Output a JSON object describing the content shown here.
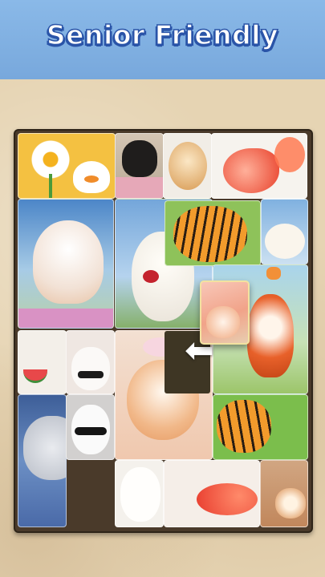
{
  "header": {
    "title": "Senior Friendly"
  },
  "colors": {
    "header_blue": "#82b2e4",
    "board_frame": "#4a3a2a",
    "paper": "#e6d4b3"
  },
  "tiles": [
    {
      "name": "daisy-duck-tile",
      "icon": "daisy-duck"
    },
    {
      "name": "black-cat-tile",
      "icon": "black-cat"
    },
    {
      "name": "fluffy-pup-tile",
      "icon": "fluffy-puppy"
    },
    {
      "name": "goldfish-tile",
      "icon": "goldfish"
    },
    {
      "name": "flower-cat-tile",
      "icon": "smiling-cat"
    },
    {
      "name": "sheep-tile",
      "icon": "sheep-with-roses"
    },
    {
      "name": "tiger-tile",
      "icon": "tiger-cub"
    },
    {
      "name": "lamb-tile",
      "icon": "lamb"
    },
    {
      "name": "fox-tile",
      "icon": "fox"
    },
    {
      "name": "watermelon-tile",
      "icon": "watermelon"
    },
    {
      "name": "bunny-tile",
      "icon": "bunny"
    },
    {
      "name": "kitten-tile",
      "icon": "kitten-with-bow"
    },
    {
      "name": "tiger-paw-tile",
      "icon": "tiger-paw"
    },
    {
      "name": "snow-leopard-tile",
      "icon": "snow-leopard"
    },
    {
      "name": "cool-bunny-tile",
      "icon": "bunny-sunglasses"
    },
    {
      "name": "fur-tile",
      "icon": "white-fur"
    },
    {
      "name": "koi-tile",
      "icon": "koi"
    },
    {
      "name": "shiba-tile",
      "icon": "shiba"
    }
  ]
}
